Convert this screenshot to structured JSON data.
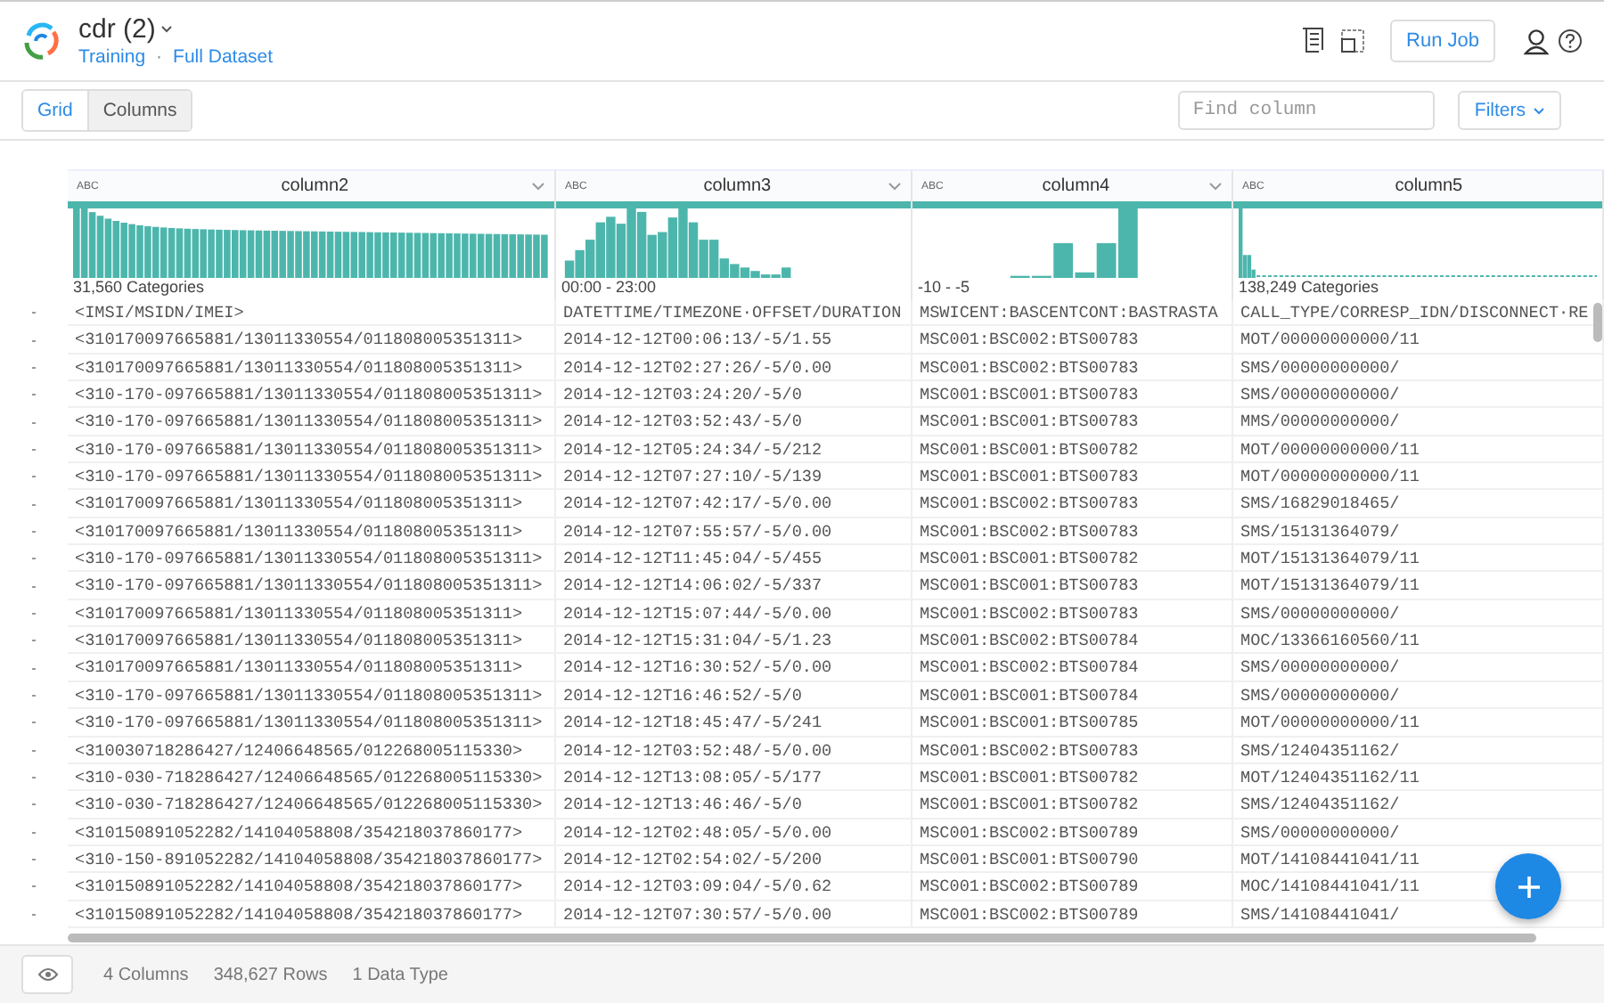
{
  "header": {
    "title": "cdr (2)",
    "breadcrumbs": [
      "Training",
      "Full Dataset"
    ],
    "separator": "·",
    "run_job": "Run Job"
  },
  "toolbar": {
    "views": [
      {
        "label": "Grid",
        "selected": true
      },
      {
        "label": "Columns",
        "selected": false
      }
    ],
    "search": {
      "placeholder": "Find column"
    },
    "filters": "Filters"
  },
  "columns": [
    {
      "type": "ABC",
      "name": "column2",
      "caret": true,
      "summary": "31,560 Categories"
    },
    {
      "type": "ABC",
      "name": "column3",
      "caret": true,
      "summary": "00:00 - 23:00"
    },
    {
      "type": "ABC",
      "name": "column4",
      "caret": true,
      "summary": "-10 - -5"
    },
    {
      "type": "ABC",
      "name": "column5",
      "caret": false,
      "summary": "138,249 Categories"
    }
  ],
  "rows": [
    [
      "<IMSI/MSIDN/IMEI>",
      "DATETTIME/TIMEZONE·OFFSET/DURATION",
      "MSWICENT:BASCENTCONT:BASTRASTA",
      "CALL_TYPE/CORRESP_IDN/DISCONNECT·RE"
    ],
    [
      "<310170097665881/13011330554/011808005351311>",
      "2014-12-12T00:06:13/-5/1.55",
      "MSC001:BSC002:BTS00783",
      "MOT/00000000000/11"
    ],
    [
      "<310170097665881/13011330554/011808005351311>",
      "2014-12-12T02:27:26/-5/0.00",
      "MSC001:BSC002:BTS00783",
      "SMS/00000000000/"
    ],
    [
      "<310-170-097665881/13011330554/011808005351311>",
      "2014-12-12T03:24:20/-5/0",
      "MSC001:BSC001:BTS00783",
      "SMS/00000000000/"
    ],
    [
      "<310-170-097665881/13011330554/011808005351311>",
      "2014-12-12T03:52:43/-5/0",
      "MSC001:BSC001:BTS00783",
      "MMS/00000000000/"
    ],
    [
      "<310-170-097665881/13011330554/011808005351311>",
      "2014-12-12T05:24:34/-5/212",
      "MSC001:BSC001:BTS00782",
      "MOT/00000000000/11"
    ],
    [
      "<310-170-097665881/13011330554/011808005351311>",
      "2014-12-12T07:27:10/-5/139",
      "MSC001:BSC001:BTS00783",
      "MOT/00000000000/11"
    ],
    [
      "<310170097665881/13011330554/011808005351311>",
      "2014-12-12T07:42:17/-5/0.00",
      "MSC001:BSC002:BTS00783",
      "SMS/16829018465/"
    ],
    [
      "<310170097665881/13011330554/011808005351311>",
      "2014-12-12T07:55:57/-5/0.00",
      "MSC001:BSC002:BTS00783",
      "SMS/15131364079/"
    ],
    [
      "<310-170-097665881/13011330554/011808005351311>",
      "2014-12-12T11:45:04/-5/455",
      "MSC001:BSC001:BTS00782",
      "MOT/15131364079/11"
    ],
    [
      "<310-170-097665881/13011330554/011808005351311>",
      "2014-12-12T14:06:02/-5/337",
      "MSC001:BSC001:BTS00783",
      "MOT/15131364079/11"
    ],
    [
      "<310170097665881/13011330554/011808005351311>",
      "2014-12-12T15:07:44/-5/0.00",
      "MSC001:BSC002:BTS00783",
      "SMS/00000000000/"
    ],
    [
      "<310170097665881/13011330554/011808005351311>",
      "2014-12-12T15:31:04/-5/1.23",
      "MSC001:BSC002:BTS00784",
      "MOC/13366160560/11"
    ],
    [
      "<310170097665881/13011330554/011808005351311>",
      "2014-12-12T16:30:52/-5/0.00",
      "MSC001:BSC002:BTS00784",
      "SMS/00000000000/"
    ],
    [
      "<310-170-097665881/13011330554/011808005351311>",
      "2014-12-12T16:46:52/-5/0",
      "MSC001:BSC001:BTS00784",
      "SMS/00000000000/"
    ],
    [
      "<310-170-097665881/13011330554/011808005351311>",
      "2014-12-12T18:45:47/-5/241",
      "MSC001:BSC001:BTS00785",
      "MOT/00000000000/11"
    ],
    [
      "<310030718286427/12406648565/012268005115330>",
      "2014-12-12T03:52:48/-5/0.00",
      "MSC001:BSC002:BTS00783",
      "SMS/12404351162/"
    ],
    [
      "<310-030-718286427/12406648565/012268005115330>",
      "2014-12-12T13:08:05/-5/177",
      "MSC001:BSC001:BTS00782",
      "MOT/12404351162/11"
    ],
    [
      "<310-030-718286427/12406648565/012268005115330>",
      "2014-12-12T13:46:46/-5/0",
      "MSC001:BSC001:BTS00782",
      "SMS/12404351162/"
    ],
    [
      "<310150891052282/14104058808/354218037860177>",
      "2014-12-12T02:48:05/-5/0.00",
      "MSC001:BSC002:BTS00789",
      "SMS/00000000000/"
    ],
    [
      "<310-150-891052282/14104058808/354218037860177>",
      "2014-12-12T02:54:02/-5/200",
      "MSC001:BSC001:BTS00790",
      "MOT/14108441041/11"
    ],
    [
      "<310150891052282/14104058808/354218037860177>",
      "2014-12-12T03:09:04/-5/0.62",
      "MSC001:BSC002:BTS00789",
      "MOC/14108441041/11"
    ],
    [
      "<310150891052282/14104058808/354218037860177>",
      "2014-12-12T07:30:57/-5/0.00",
      "MSC001:BSC002:BTS00789",
      "SMS/14108441041/"
    ]
  ],
  "status_bar": {
    "items": [
      "4 Columns",
      "348,627 Rows",
      "1 Data Type"
    ]
  }
}
